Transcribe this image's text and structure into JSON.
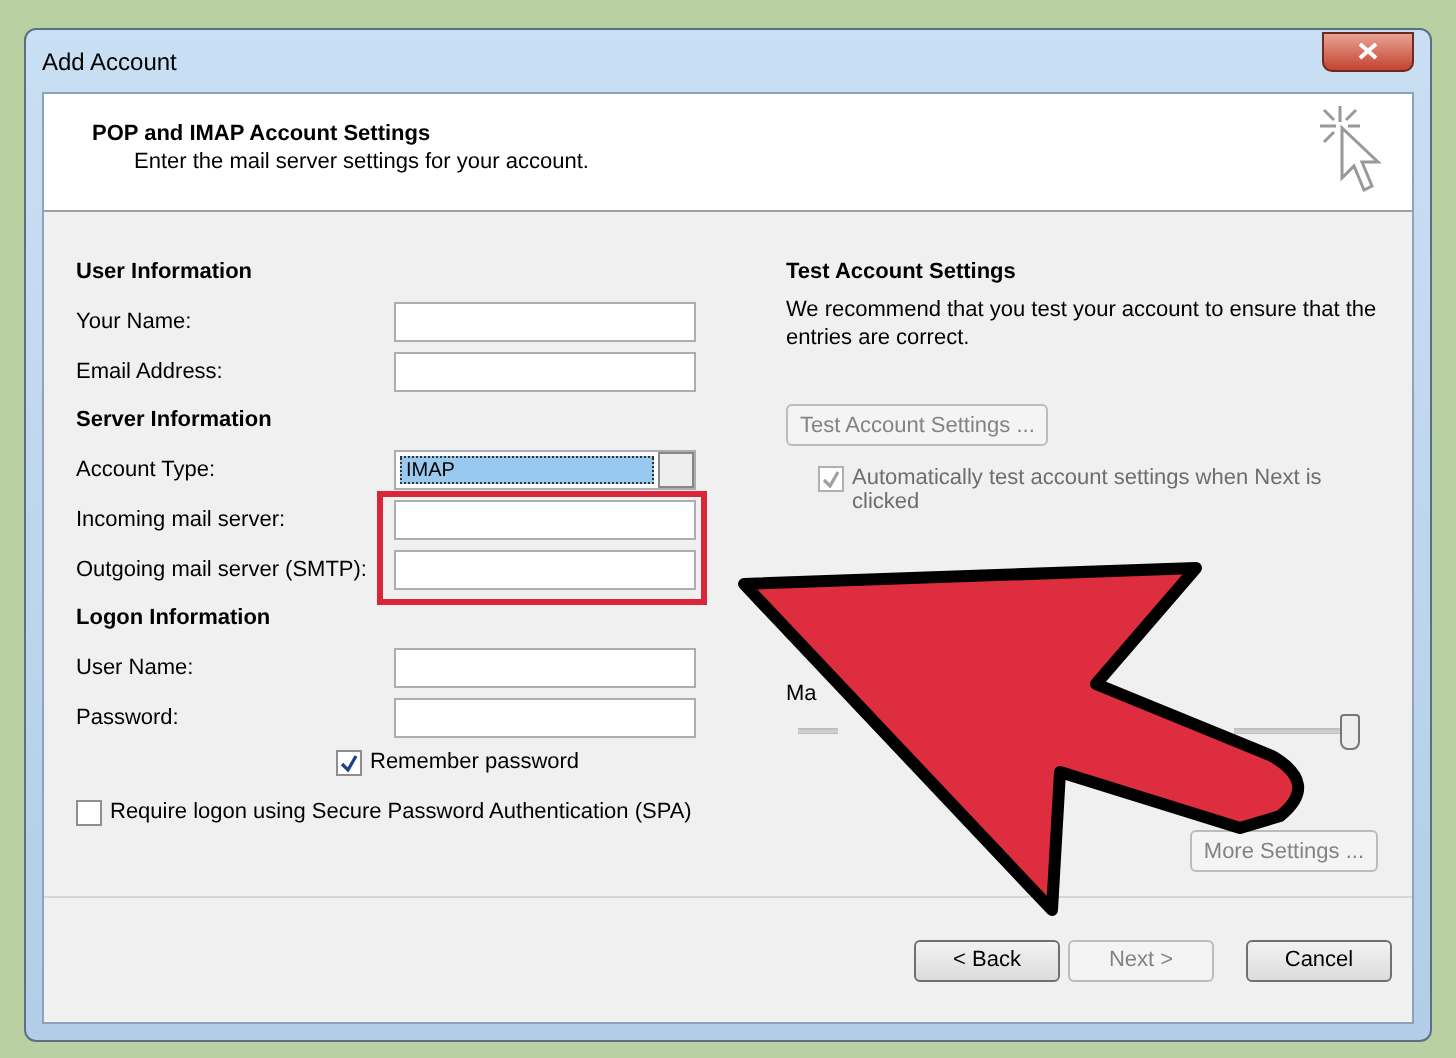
{
  "window": {
    "title": "Add Account"
  },
  "header": {
    "title": "POP and IMAP Account Settings",
    "subtitle": "Enter the mail server settings for your account."
  },
  "left_sections": [
    {
      "heading": "User Information",
      "fields": [
        {
          "label": "Your Name:",
          "kind": "text"
        },
        {
          "label": "Email Address:",
          "kind": "text"
        }
      ]
    },
    {
      "heading": "Server Information",
      "fields": [
        {
          "label": "Account Type:",
          "kind": "combo",
          "value": "IMAP"
        },
        {
          "label": "Incoming mail server:",
          "kind": "text"
        },
        {
          "label": "Outgoing mail server (SMTP):",
          "kind": "text"
        }
      ]
    },
    {
      "heading": "Logon Information",
      "fields": [
        {
          "label": "User Name:",
          "kind": "text"
        },
        {
          "label": "Password:",
          "kind": "text"
        }
      ]
    }
  ],
  "remember_password": {
    "label": "Remember password",
    "checked": true
  },
  "spa": {
    "label": "Require logon using Secure Password Authentication (SPA)",
    "checked": false
  },
  "test_settings": {
    "heading": "Test Account Settings",
    "text": "We recommend that you test your account to ensure that the entries are correct.",
    "button": {
      "label": "Test Account Settings ...",
      "disabled": true
    },
    "auto_test": {
      "label": "Automatically test account settings when Next is clicked",
      "checked": true,
      "disabled": true
    }
  },
  "slider": {
    "label": "Ma",
    "level": 1
  },
  "more_settings": {
    "label": "More Settings ...",
    "disabled": true
  },
  "footer_buttons": [
    {
      "label": "< Back",
      "disabled": false
    },
    {
      "label": "Next >",
      "disabled": true
    },
    {
      "label": "Cancel",
      "disabled": false
    }
  ]
}
